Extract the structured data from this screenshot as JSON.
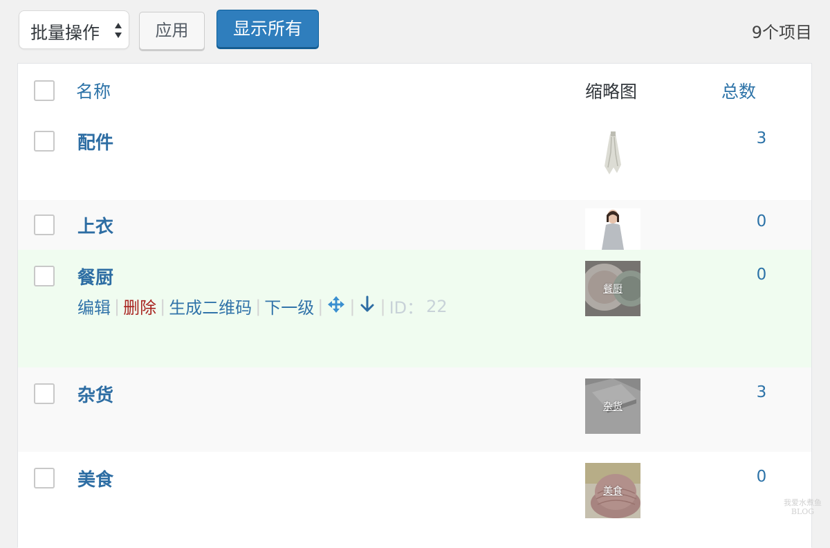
{
  "toolbar": {
    "bulk_actions_label": "批量操作",
    "apply_label": "应用",
    "show_all_label": "显示所有",
    "item_count": "9个项目"
  },
  "table": {
    "headers": {
      "name": "名称",
      "thumbnail": "缩略图",
      "count": "总数"
    },
    "rows": [
      {
        "name": "配件",
        "count": "3",
        "thumb_label": ""
      },
      {
        "name": "上衣",
        "count": "0",
        "thumb_label": ""
      },
      {
        "name": "餐厨",
        "count": "0",
        "thumb_label": "餐厨"
      },
      {
        "name": "杂货",
        "count": "3",
        "thumb_label": "杂货"
      },
      {
        "name": "美食",
        "count": "0",
        "thumb_label": "美食"
      }
    ],
    "row_actions": {
      "edit": "编辑",
      "delete": "删除",
      "qrcode": "生成二维码",
      "child": "下一级",
      "separator": "|",
      "id_label": "ID：",
      "id_value": "22"
    }
  },
  "watermark": {
    "line1": "我爱水煮鱼",
    "line2": "BLOG"
  },
  "colors": {
    "link": "#2d73a8",
    "primary_button": "#2f7ebd",
    "delete": "#a8231f",
    "row_alt": "#f9f9f9",
    "row_hover": "#f0fcf0"
  },
  "icons": [
    "sort-arrows-icon",
    "move-icon",
    "arrow-down-icon"
  ]
}
